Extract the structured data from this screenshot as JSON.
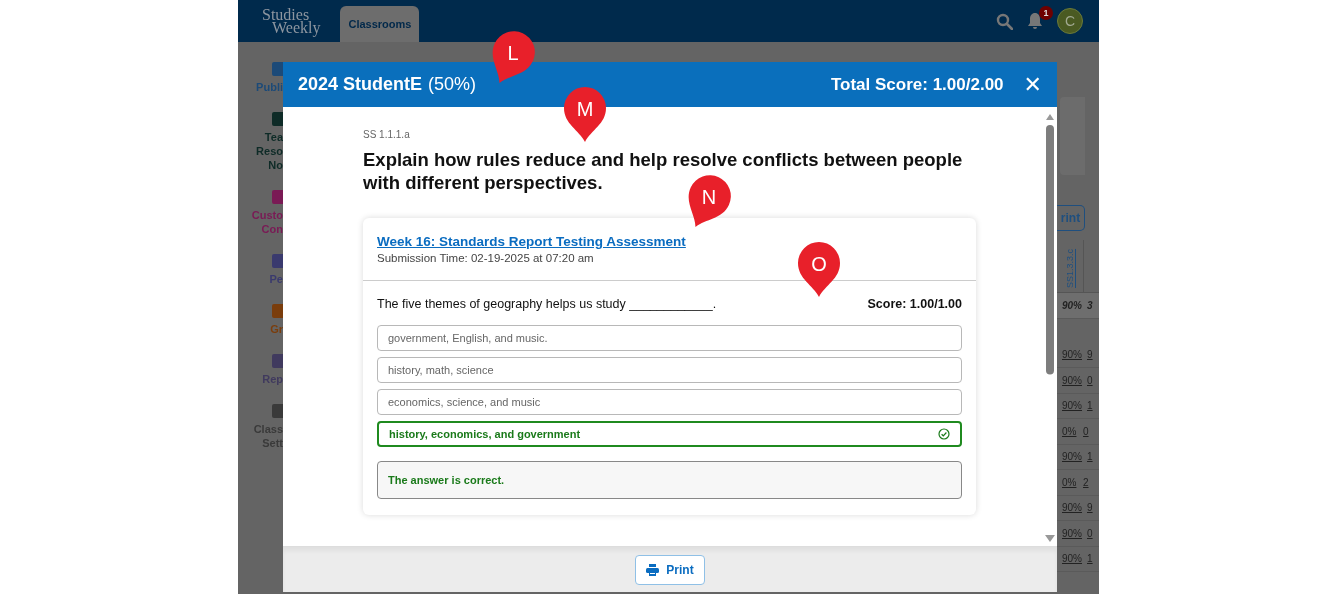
{
  "app_header": {
    "logo_lines": [
      "Studies",
      "Weekly"
    ],
    "tabs": [
      {
        "label": "Classrooms",
        "selected": true
      }
    ],
    "notification_count": "1",
    "avatar_letter": "C"
  },
  "sidebar": {
    "items": [
      {
        "lines": [
          "Publi"
        ],
        "color": "#1c4a78"
      },
      {
        "lines": [
          "Tea",
          "Reso",
          "No"
        ],
        "color": "#0e2b27"
      },
      {
        "lines": [
          "Custo",
          "Con"
        ],
        "color": "#7a1a55"
      },
      {
        "lines": [
          "Pe"
        ],
        "color": "#3a3a6e"
      },
      {
        "lines": [
          "Gr"
        ],
        "color": "#7a3d0c"
      },
      {
        "lines": [
          "Rep"
        ],
        "color": "#403a5e"
      },
      {
        "lines": [
          "Class",
          "Sett"
        ],
        "color": "#3a3a3a"
      }
    ]
  },
  "background_table": {
    "button": "rint",
    "columns": [
      "SS1.3.3.c"
    ],
    "average_row": [
      "90%",
      "3"
    ],
    "rows": [
      [
        "90%",
        "9"
      ],
      [
        "90%",
        "0"
      ],
      [
        "90%",
        "1"
      ],
      [
        "0%",
        "0"
      ],
      [
        "90%",
        "1"
      ],
      [
        "0%",
        "2"
      ],
      [
        "90%",
        "9"
      ],
      [
        "90%",
        "0"
      ],
      [
        "90%",
        "1"
      ]
    ]
  },
  "modal": {
    "title": "2024 StudentE",
    "title_percent": "(50%)",
    "total_score": "Total Score: 1.00/2.00",
    "close": "✕",
    "standard": "SS 1.1.1.a",
    "question": "Explain how rules reduce and help resolve conflicts between people with different perspectives.",
    "submission": {
      "link": "Week 16: Standards Report Testing Assessment",
      "time": "Submission Time: 02-19-2025 at 07:20 am"
    },
    "item": {
      "prompt": "The five themes of geography helps us study ____________.",
      "score": "Score: 1.00/1.00",
      "options": [
        {
          "text": "government, English, and music.",
          "correct": false
        },
        {
          "text": "history, math, science",
          "correct": false
        },
        {
          "text": "economics, science, and music",
          "correct": false
        },
        {
          "text": "history, economics, and government",
          "correct": true
        }
      ],
      "feedback": "The answer is correct."
    },
    "footer": {
      "print_button": "Print"
    }
  },
  "callouts": [
    {
      "label": "L"
    },
    {
      "label": "M"
    },
    {
      "label": "N"
    },
    {
      "label": "O"
    }
  ]
}
